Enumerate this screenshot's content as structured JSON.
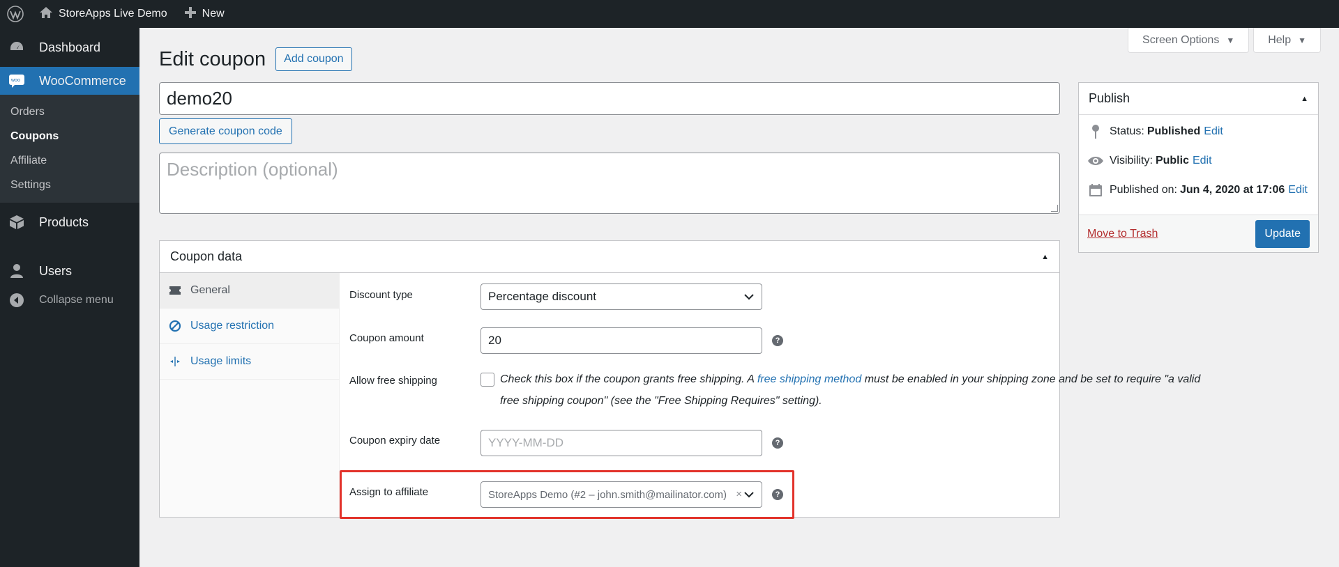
{
  "adminbar": {
    "site_name": "StoreApps Live Demo",
    "new_label": "New"
  },
  "sidebar": {
    "items": [
      {
        "label": "Dashboard",
        "icon": "dashboard-icon"
      },
      {
        "label": "WooCommerce",
        "icon": "woocommerce-icon"
      },
      {
        "label": "Products",
        "icon": "products-icon"
      },
      {
        "label": "Users",
        "icon": "users-icon"
      },
      {
        "label": "Collapse menu",
        "icon": "collapse-icon"
      }
    ],
    "submenu": [
      "Orders",
      "Coupons",
      "Affiliate",
      "Settings"
    ],
    "current_submenu": "Coupons"
  },
  "screen_meta": {
    "screen_options": "Screen Options",
    "help": "Help"
  },
  "page": {
    "title": "Edit coupon",
    "add_button": "Add coupon",
    "coupon_code": "demo20",
    "generate_button": "Generate coupon code",
    "description_placeholder": "Description (optional)"
  },
  "coupon_data": {
    "title": "Coupon data",
    "tabs": [
      {
        "label": "General",
        "icon": "ticket-icon",
        "active": true
      },
      {
        "label": "Usage restriction",
        "icon": "block-icon",
        "active": false
      },
      {
        "label": "Usage limits",
        "icon": "limits-icon",
        "active": false
      }
    ],
    "fields": {
      "discount_type": {
        "label": "Discount type",
        "value": "Percentage discount"
      },
      "coupon_amount": {
        "label": "Coupon amount",
        "value": "20"
      },
      "free_shipping": {
        "label": "Allow free shipping",
        "desc_before": "Check this box if the coupon grants free shipping. A ",
        "desc_link": "free shipping method",
        "desc_after": " must be enabled in your shipping zone and be set to require \"a valid free shipping coupon\" (see the \"Free Shipping Requires\" setting).",
        "checked": false
      },
      "expiry": {
        "label": "Coupon expiry date",
        "placeholder": "YYYY-MM-DD"
      },
      "affiliate": {
        "label": "Assign to affiliate",
        "value": "StoreApps Demo (#2 – john.smith@mailinator.com)",
        "clear": "×"
      }
    },
    "help_glyph": "?"
  },
  "publish": {
    "title": "Publish",
    "status_label": "Status:",
    "status_value": "Published",
    "visibility_label": "Visibility:",
    "visibility_value": "Public",
    "published_label": "Published on:",
    "published_value": "Jun 4, 2020 at 17:06",
    "edit": "Edit",
    "trash": "Move to Trash",
    "update": "Update"
  },
  "colors": {
    "admin_dark": "#1d2327",
    "accent": "#2271b1",
    "highlight": "#e2332b"
  }
}
